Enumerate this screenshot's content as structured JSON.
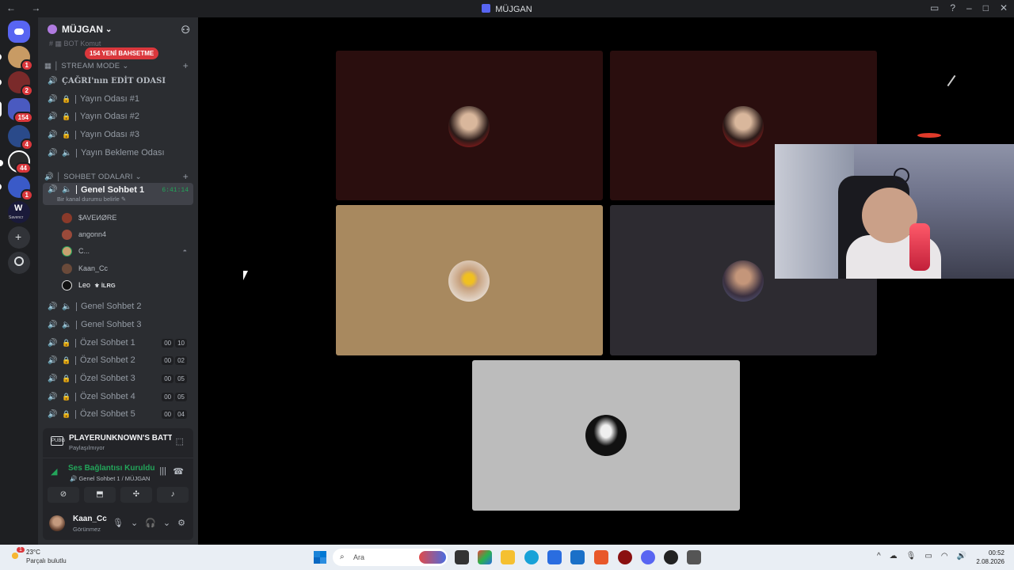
{
  "titlebar": {
    "title": "MÜJGAN",
    "nav": "← →",
    "icons": [
      "inbox-icon",
      "help-icon",
      "minimize",
      "maximize",
      "close"
    ]
  },
  "server_rail": [
    {
      "name": "discord-home",
      "color": "#5865f2"
    },
    {
      "name": "server-1",
      "badge": "1",
      "color": "#c89b64"
    },
    {
      "name": "server-2",
      "badge": "2",
      "color": "#7a2a2a"
    },
    {
      "name": "server-3",
      "badge": "154",
      "color": "#4a5ac0"
    },
    {
      "name": "server-4",
      "badge": "4",
      "color": "#2a4a8a"
    },
    {
      "name": "server-5",
      "badge": "44",
      "color": "#2a2a2a"
    },
    {
      "name": "server-6",
      "badge": "1",
      "color": "#3a5ac8"
    },
    {
      "name": "server-7",
      "label": "Savencr",
      "color": "#1a1a3a"
    }
  ],
  "guild": {
    "name": "MÜJGAN",
    "chevron": "⌄",
    "mentions_badge": "154 YENİ BAHSETME"
  },
  "categories": {
    "stream": "STREAM MODE",
    "chat": "SOHBET ODALARI"
  },
  "top_hidden": "BOT Komut",
  "stream_channels": [
    {
      "name": "ÇAĞRI'nın EDİT ODASI",
      "locked": false
    },
    {
      "name": "Yayın Odası #1",
      "locked": true
    },
    {
      "name": "Yayın Odası #2",
      "locked": true
    },
    {
      "name": "Yayın Odası #3",
      "locked": true
    },
    {
      "name": "Yayın Bekleme Odası",
      "locked": false
    }
  ],
  "active_channel": {
    "name": "Genel Sohbet 1",
    "timer": "6:41:14",
    "status": "Bir kanal durumu belirle"
  },
  "voice_users": [
    {
      "name": "$AVEИØRE",
      "color": "#8a3a2a"
    },
    {
      "name": "angonn4",
      "color": "#9a4a3a"
    },
    {
      "name": "C...",
      "color": "#c8a070"
    },
    {
      "name": "Kaan_Cc",
      "color": "#6a4a3a"
    },
    {
      "name": "Leo",
      "tag": "⚜ İLRG",
      "color": "#ddd"
    }
  ],
  "chat_channels": [
    {
      "name": "Genel Sohbet 2",
      "locked": false
    },
    {
      "name": "Genel Sohbet 3",
      "locked": false
    },
    {
      "name": "Özel Sohbet 1",
      "locked": true,
      "a": "00",
      "b": "10"
    },
    {
      "name": "Özel Sohbet 2",
      "locked": true,
      "a": "00",
      "b": "02"
    },
    {
      "name": "Özel Sohbet 3",
      "locked": true,
      "a": "00",
      "b": "05"
    },
    {
      "name": "Özel Sohbet 4",
      "locked": true,
      "a": "00",
      "b": "05"
    },
    {
      "name": "Özel Sohbet 5",
      "locked": true,
      "a": "00",
      "b": "04"
    }
  ],
  "activity": {
    "title": "PLAYERUNKNOWN'S BATTLEGRO...",
    "subtitle": "Paylaşılmıyor",
    "icon_text": "PUBG"
  },
  "voice_connection": {
    "title": "Ses Bağlantısı Kuruldu",
    "subtitle": "Genel Sohbet 1 / MÜJGAN"
  },
  "voice_buttons": [
    "camera-off",
    "screen-share",
    "activities",
    "soundboard"
  ],
  "user_panel": {
    "name": "Kaan_Cc",
    "status": "Görünmez"
  },
  "tiles": [
    {
      "bg": "#2a0e0e",
      "avatar_color": "#7a2a2a"
    },
    {
      "bg": "#2a0e0e",
      "avatar_color": "#8a2a2a"
    },
    {
      "bg": "#a8895f",
      "avatar_color": "#c8a070"
    },
    {
      "bg": "#2d2b31",
      "avatar_color": "#4a4a58"
    },
    {
      "bg": "#bcbcbc",
      "avatar_color": "#111"
    }
  ],
  "taskbar": {
    "weather_temp": "23°C",
    "weather_desc": "Parçalı bulutlu",
    "weather_badge": "1",
    "search_placeholder": "Ara",
    "clock_time": "00:52",
    "clock_date": "2.08.2026"
  }
}
